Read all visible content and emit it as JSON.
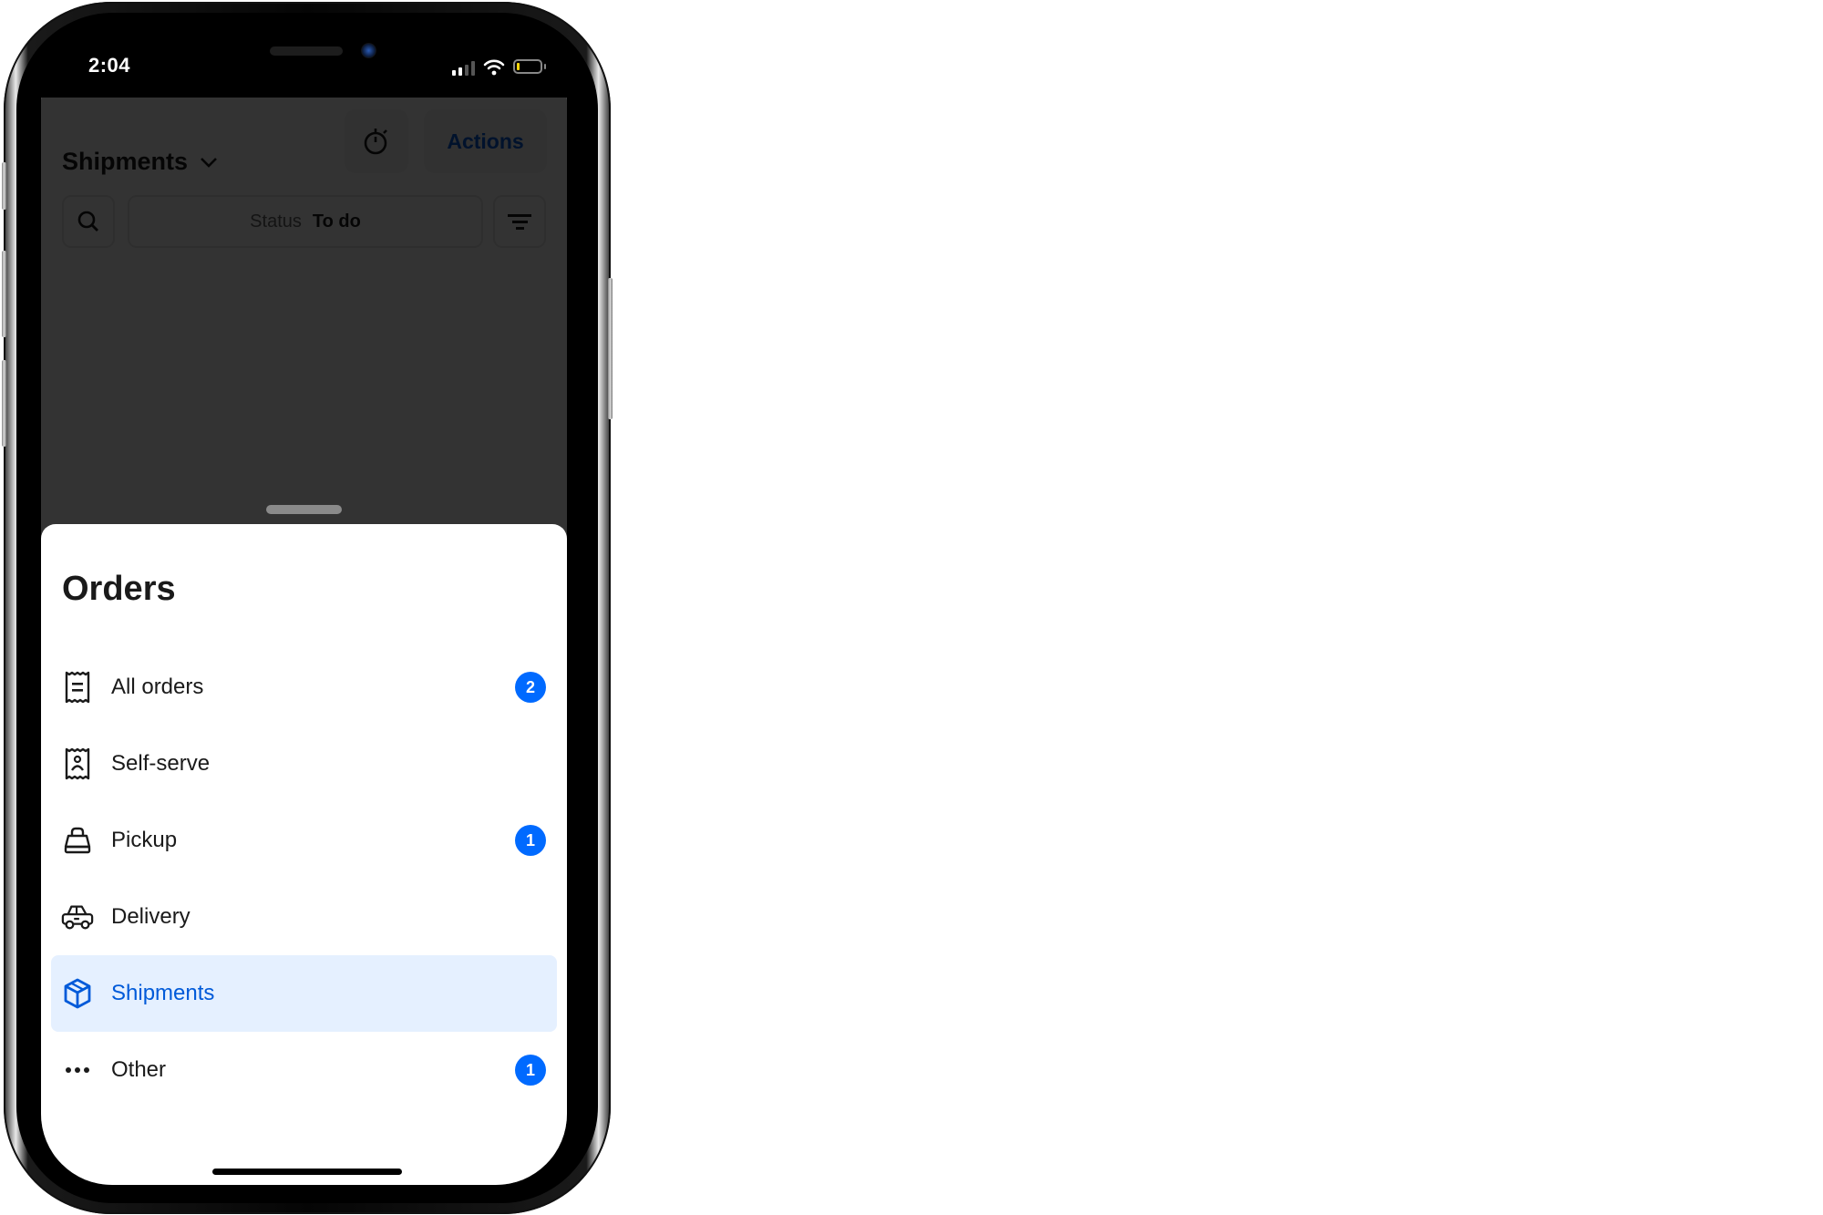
{
  "status_bar": {
    "time": "2:04",
    "signal_bars_active": 2,
    "signal_bars_total": 4,
    "battery_level": 0.1,
    "battery_color": "#ffd60a"
  },
  "header": {
    "title": "Shipments",
    "dropdown_icon": "chevron-down-icon",
    "timer_icon": "stopwatch-icon",
    "actions_label": "Actions"
  },
  "filters": {
    "search_icon": "search-icon",
    "status_label": "Status",
    "status_value": "To do",
    "filter_icon": "filter-icon"
  },
  "sheet": {
    "title": "Orders",
    "items": [
      {
        "label": "All orders",
        "icon": "receipt-icon",
        "badge": "2",
        "selected": false
      },
      {
        "label": "Self-serve",
        "icon": "self-serve-receipt-icon",
        "badge": null,
        "selected": false
      },
      {
        "label": "Pickup",
        "icon": "shopping-bag-icon",
        "badge": "1",
        "selected": false
      },
      {
        "label": "Delivery",
        "icon": "car-icon",
        "badge": null,
        "selected": false
      },
      {
        "label": "Shipments",
        "icon": "box-icon",
        "badge": null,
        "selected": true
      },
      {
        "label": "Other",
        "icon": "more-dots-icon",
        "badge": "1",
        "selected": false
      }
    ]
  },
  "colors": {
    "accent": "#005ad9",
    "badge": "#006aff",
    "selected_bg": "#e5f0ff",
    "overlay": "rgba(0,0,0,0.8)"
  }
}
